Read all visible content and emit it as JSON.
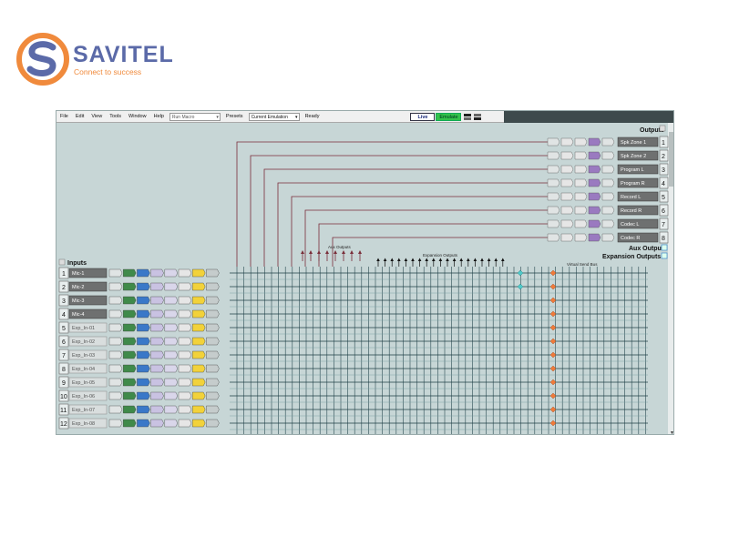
{
  "logo": {
    "name": "SAVITEL",
    "tagline": "Connect to success",
    "colors": {
      "blue": "#5b6aa8",
      "orange": "#f08a3c"
    }
  },
  "menubar": {
    "items": [
      "File",
      "Edit",
      "View",
      "Tools",
      "Window",
      "Help"
    ],
    "macro_placeholder": "Run Macro",
    "presets_label": "Presets",
    "presets_value": "Current Emulation",
    "status": "Ready",
    "live_label": "Live",
    "emulate_label": "Emulate"
  },
  "outputs": {
    "header": "Outputs",
    "items": [
      {
        "num": "1",
        "name": "Spk Zone 1"
      },
      {
        "num": "2",
        "name": "Spk Zone 2"
      },
      {
        "num": "3",
        "name": "Program L"
      },
      {
        "num": "4",
        "name": "Program R"
      },
      {
        "num": "5",
        "name": "Record L"
      },
      {
        "num": "6",
        "name": "Record R"
      },
      {
        "num": "7",
        "name": "Codec L"
      },
      {
        "num": "8",
        "name": "Codec R"
      }
    ],
    "aux_label": "Aux Outputs",
    "expansion_label": "Expansion Outputs"
  },
  "matrix": {
    "aux_outputs_label": "Aux Outputs",
    "expansion_outputs_label": "Expansion Outputs",
    "virtual_send_bus_label": "Virtual Send Bus"
  },
  "inputs": {
    "header": "Inputs",
    "items": [
      {
        "num": "1",
        "name": "Mic-1"
      },
      {
        "num": "2",
        "name": "Mic-2"
      },
      {
        "num": "3",
        "name": "Mic-3"
      },
      {
        "num": "4",
        "name": "Mic-4"
      },
      {
        "num": "5",
        "name": "Exp_In-01"
      },
      {
        "num": "6",
        "name": "Exp_In-02"
      },
      {
        "num": "7",
        "name": "Exp_In-03"
      },
      {
        "num": "8",
        "name": "Exp_In-04"
      },
      {
        "num": "9",
        "name": "Exp_In-05"
      },
      {
        "num": "10",
        "name": "Exp_In-06"
      },
      {
        "num": "11",
        "name": "Exp_In-07"
      },
      {
        "num": "12",
        "name": "Exp_In-08"
      }
    ]
  },
  "colors": {
    "canvas_bg": "#c7d6d6",
    "route_line": "#7a2e3a",
    "grid_line": "#2a4a52",
    "cyan_node": "#4fc9c9",
    "orange_node": "#f07a3a",
    "input_block_colors": [
      "#e0e4e4",
      "#3f8a4a",
      "#3a78c8",
      "#c9c2e2",
      "#d9d6ea",
      "#e6e6e6",
      "#f2d23a"
    ],
    "output_block_colors": [
      "#e0e4e4",
      "#e6e6e6",
      "#e6e6e6",
      "#9a7ac0",
      "#e0e4e4"
    ]
  }
}
